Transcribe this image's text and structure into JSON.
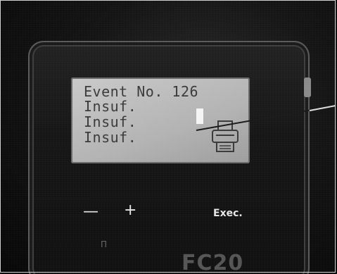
{
  "display": {
    "lines": [
      "Event No. 126",
      "Insuf.",
      "Insuf.",
      "Insuf."
    ],
    "icon": "printer-icon"
  },
  "keys": {
    "minus": "—",
    "plus": "+",
    "exec": "Exec."
  },
  "device": {
    "brand": "FC20",
    "mark": "Π"
  },
  "colors": {
    "lcd_background": "#b8b8b8",
    "lcd_text": "#3a3a3a",
    "casing": "#141414"
  }
}
